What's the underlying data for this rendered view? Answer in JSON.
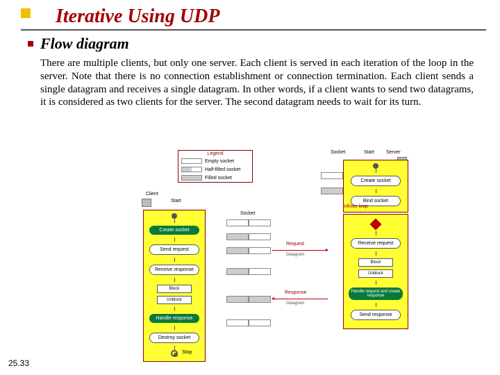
{
  "title": "Iterative Using UDP",
  "subtitle": "Flow diagram",
  "body": "There are multiple clients, but only one server. Each client is served in each iteration of the loop in the server. Note that there is no connection establishment or connection termination. Each client sends a single datagram and receives a single datagram. In other words, if a client wants to send two datagrams, it is considered as two clients for the server. The second datagram needs to wait for its turn.",
  "page_number": "25.33",
  "diagram": {
    "legend": {
      "title": "Legend",
      "rows": [
        "Empty socket",
        "Half-filled socket",
        "Filled socket"
      ]
    },
    "client": {
      "label": "Client",
      "start": "Start",
      "steps": [
        "Create socket",
        "Send request",
        "Receive response",
        "Block",
        "Unblock",
        "Handle response",
        "Destroy socket"
      ],
      "stop": "Stop"
    },
    "server": {
      "label": "Server",
      "start": "Start",
      "steps": [
        "Create socket",
        "Bind socket",
        "Receive request",
        "Block",
        "Unblock",
        "Handle request and create response",
        "Send response"
      ],
      "loop_label": "Infinite loop",
      "socket_label": "Socket"
    },
    "channel": {
      "socket_label": "Socket",
      "request": "Request",
      "response": "Response",
      "datagram": "Datagram"
    }
  }
}
